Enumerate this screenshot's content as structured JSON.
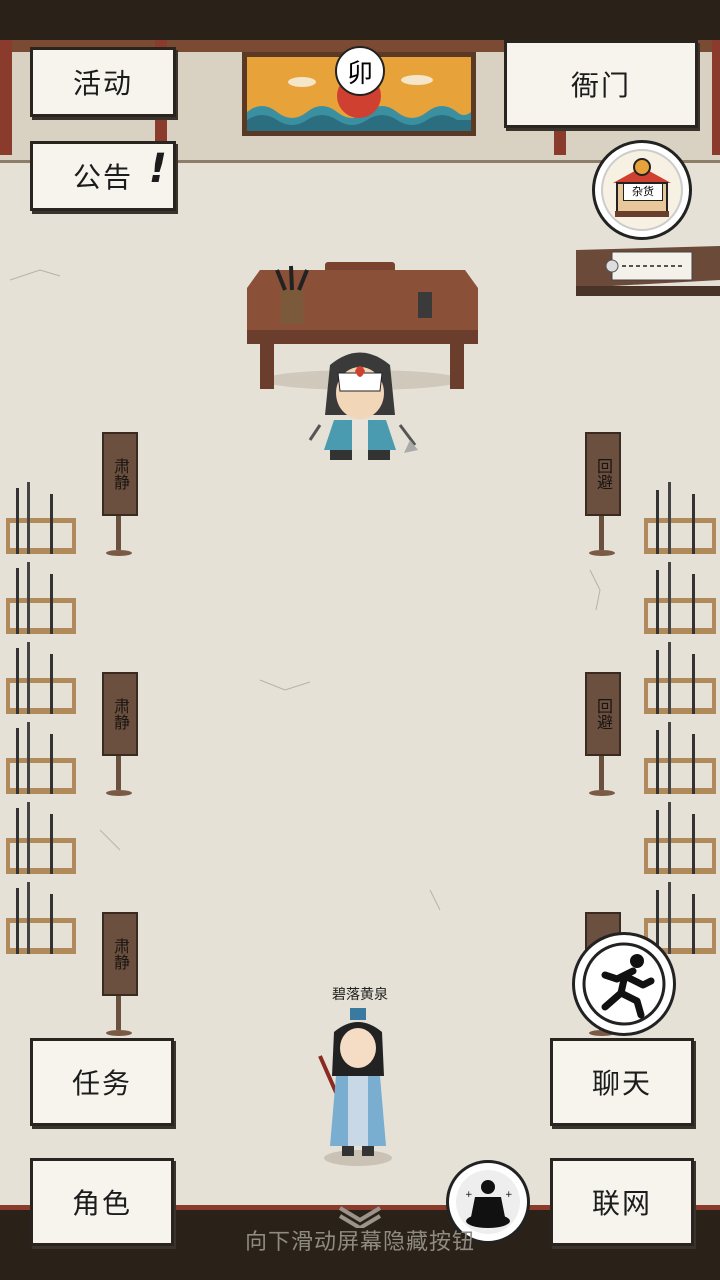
{
  "buttons": {
    "activity": "活动",
    "notice": "公告",
    "notice_mark": "!",
    "yamen": "衙门",
    "task": "任务",
    "chat": "聊天",
    "role": "角色",
    "network": "联网"
  },
  "painting": {
    "seal_char": "卯"
  },
  "shop": {
    "sign": "杂货"
  },
  "signs": {
    "left": [
      "肃静",
      "肃静",
      "肃静"
    ],
    "right": [
      "回避",
      "回避",
      "回避"
    ]
  },
  "player": {
    "name": "碧落黄泉"
  },
  "hint": "向下滑动屏幕隐藏按钮",
  "colors": {
    "wood": "#6b3d2c",
    "paper": "#f7f4ee",
    "floor": "#e6e1d6",
    "accent": "#8a3b2c"
  },
  "icons": [
    "shop-icon",
    "run-icon",
    "meditate-icon",
    "chevron-down-icon"
  ]
}
